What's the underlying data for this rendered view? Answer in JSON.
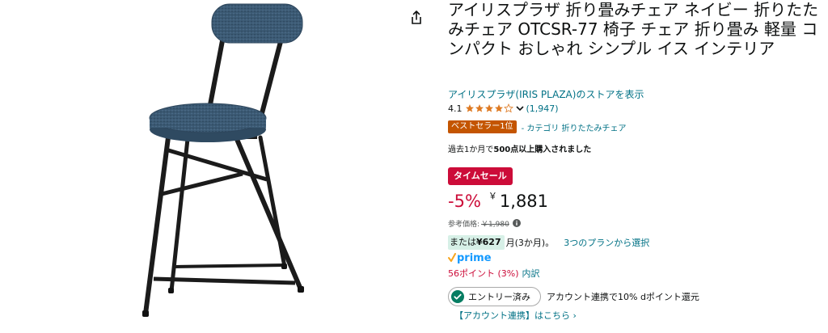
{
  "product": {
    "title": "アイリスプラザ 折り畳みチェア ネイビー 折りたたみチェア OTCSR-77 椅子 チェア 折り畳み 軽量 コンパクト おしゃれ シンプル イス インテリア",
    "store_link": "アイリスプラザ(IRIS PLAZA)のストアを表示",
    "image_icon": "navy-folding-chair-image",
    "share_icon": "share-icon"
  },
  "rating": {
    "value": "4.1",
    "stars": 4.1,
    "count": "(1,947)"
  },
  "bestseller": {
    "badge": "ベストセラー1位",
    "category": "- カテゴリ 折りたたみチェア"
  },
  "bought": {
    "prefix": "過去1か月で",
    "bold": "500点以上購入されました"
  },
  "deal": {
    "badge": "タイムセール"
  },
  "price": {
    "discount": "-5%",
    "currency": "￥",
    "amount": "1,881"
  },
  "list_price": {
    "label": "参考価格:",
    "value": "￥1,980"
  },
  "installment": {
    "prefix": "または",
    "amount": "¥627",
    "term": "月(3か月)。",
    "link": "3つのプランから選択"
  },
  "prime": {
    "label": "prime"
  },
  "points": {
    "text": "56ポイント (3%)",
    "breakdown": "内訳"
  },
  "entry": {
    "pill": "エントリー済み",
    "text": "アカウント連携で10% dポイント還元"
  },
  "account_link": {
    "text": "【アカウント連携】はこちら ›"
  },
  "colors": {
    "link": "#007185",
    "deal_red": "#cc0c39",
    "bestseller_orange": "#c45500",
    "star": "#de7921",
    "chair_fabric": "#3a5670",
    "install_bg": "#d7f0e7"
  }
}
